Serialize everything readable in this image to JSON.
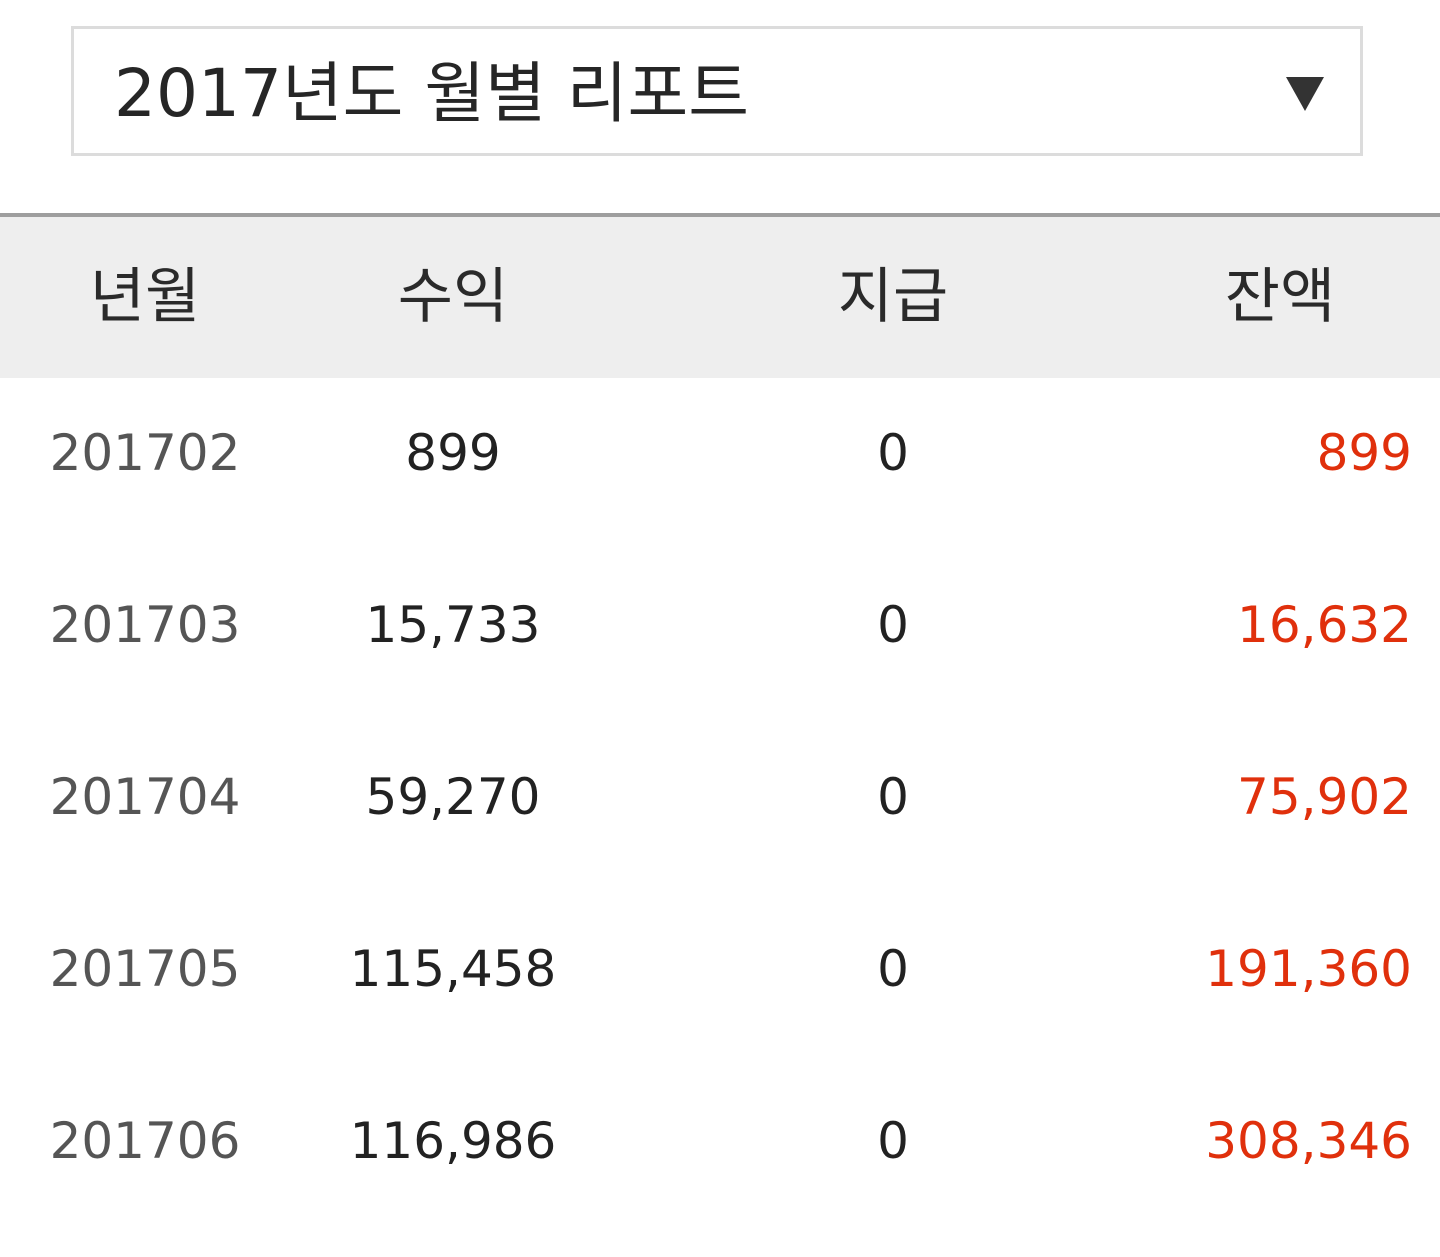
{
  "report_selector": {
    "selected": "2017년도 월별 리포트",
    "arrow_icon": "triangle-down-icon"
  },
  "table": {
    "headers": {
      "month": "년월",
      "income": "수익",
      "paid": "지급",
      "balance": "잔액"
    },
    "rows": [
      {
        "month": "201702",
        "income": "899",
        "paid": "0",
        "balance": "899"
      },
      {
        "month": "201703",
        "income": "15,733",
        "paid": "0",
        "balance": "16,632"
      },
      {
        "month": "201704",
        "income": "59,270",
        "paid": "0",
        "balance": "75,902"
      },
      {
        "month": "201705",
        "income": "115,458",
        "paid": "0",
        "balance": "191,360"
      },
      {
        "month": "201706",
        "income": "116,986",
        "paid": "0",
        "balance": "308,346"
      }
    ]
  },
  "colors": {
    "balance": "#e0300c",
    "header_bg": "#eeeeee"
  }
}
